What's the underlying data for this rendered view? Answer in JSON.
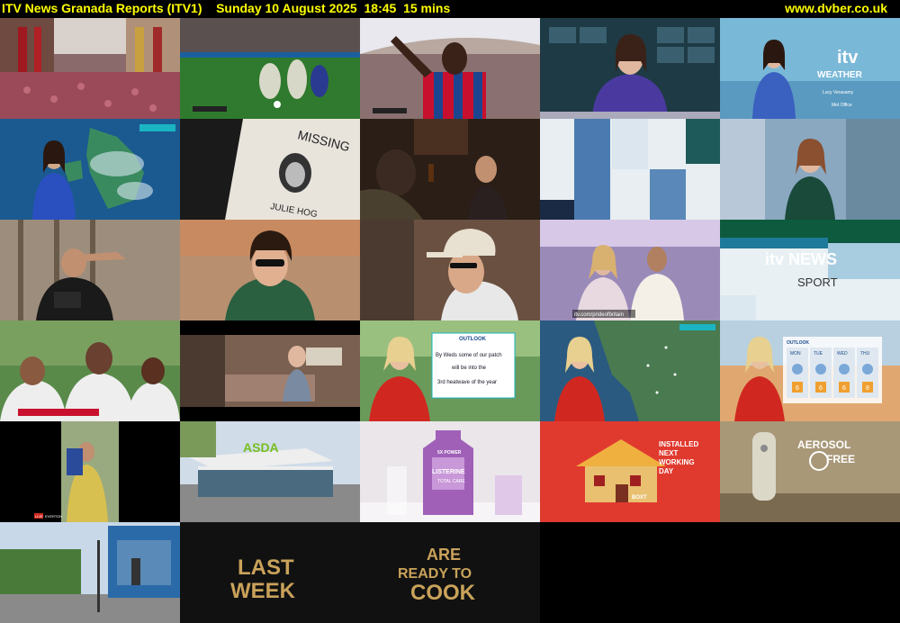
{
  "header": {
    "channel": "ITV News Granada Reports (ITV1)",
    "date": "Sunday 10 August 2025",
    "time": "18:45",
    "duration": "15 mins",
    "site": "www.dvber.co.uk"
  },
  "tiles": {
    "weather_brand": "itv",
    "weather_word": "WEATHER",
    "weather_presenter": "Lucy Verasamy",
    "met_office": "Met Office",
    "missing_word": "MISSING",
    "missing_name": "JULIE HOG",
    "pride_url": "itv.com/prideofbritain",
    "news_brand": "itv NEWS",
    "sport_word": "SPORT",
    "outlook_title": "OUTLOOK",
    "outlook_line1": "By Weds some of our patch",
    "outlook_line2": "will be into the",
    "outlook_line3": "3rd heatwave of the year",
    "asda": "ASDA",
    "listerine_top": "5X POWER",
    "listerine_brand": "LISTERINE",
    "listerine_sub": "TOTAL CARE",
    "boxt_line1": "INSTALLED",
    "boxt_line2": "NEXT",
    "boxt_line3": "WORKING",
    "boxt_line4": "DAY",
    "boxt_brand": "BOXT",
    "aerosol1": "AEROSOL",
    "aerosol2": "FREE",
    "live_tag": "LIVE",
    "everton_tag": "EVERTON",
    "last_week1": "LAST",
    "last_week2": "WEEK",
    "cook1": "ARE",
    "cook2": "READY TO",
    "cook3": "COOK",
    "outlook_days": [
      "MON",
      "TUE",
      "WED",
      "THU"
    ],
    "outlook_temps": [
      "6",
      "6",
      "6",
      "8"
    ]
  },
  "colors": {
    "header_text": "#ffff00",
    "itv_teal": "#1bb4c4",
    "palace_red": "#c8102e",
    "palace_blue": "#1b458f",
    "asda_green": "#78be20",
    "boxt_red": "#e03a2f",
    "gold": "#c9a25a"
  }
}
